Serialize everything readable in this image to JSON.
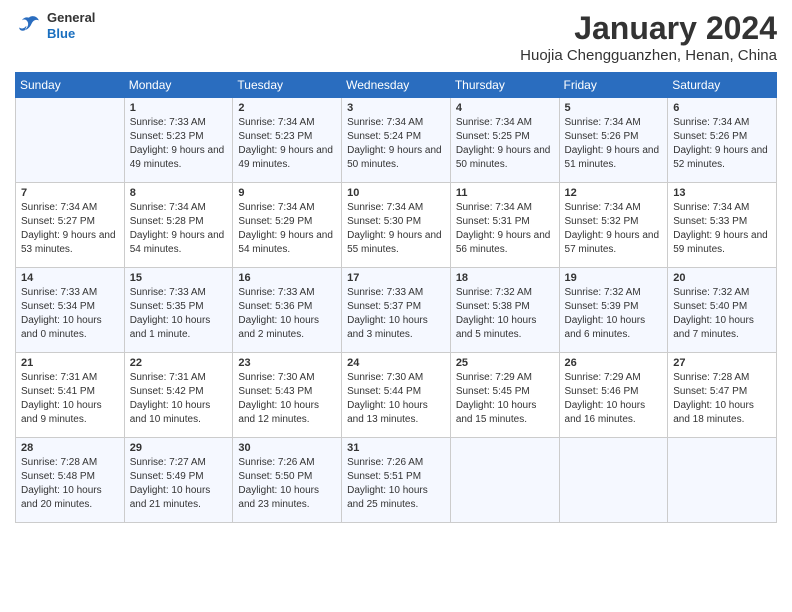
{
  "header": {
    "logo": {
      "general": "General",
      "blue": "Blue"
    },
    "title": "January 2024",
    "location": "Huojia Chengguanzhen, Henan, China"
  },
  "weekdays": [
    "Sunday",
    "Monday",
    "Tuesday",
    "Wednesday",
    "Thursday",
    "Friday",
    "Saturday"
  ],
  "weeks": [
    [
      {
        "day": "",
        "sunrise": "",
        "sunset": "",
        "daylight": ""
      },
      {
        "day": "1",
        "sunrise": "Sunrise: 7:33 AM",
        "sunset": "Sunset: 5:23 PM",
        "daylight": "Daylight: 9 hours and 49 minutes."
      },
      {
        "day": "2",
        "sunrise": "Sunrise: 7:34 AM",
        "sunset": "Sunset: 5:23 PM",
        "daylight": "Daylight: 9 hours and 49 minutes."
      },
      {
        "day": "3",
        "sunrise": "Sunrise: 7:34 AM",
        "sunset": "Sunset: 5:24 PM",
        "daylight": "Daylight: 9 hours and 50 minutes."
      },
      {
        "day": "4",
        "sunrise": "Sunrise: 7:34 AM",
        "sunset": "Sunset: 5:25 PM",
        "daylight": "Daylight: 9 hours and 50 minutes."
      },
      {
        "day": "5",
        "sunrise": "Sunrise: 7:34 AM",
        "sunset": "Sunset: 5:26 PM",
        "daylight": "Daylight: 9 hours and 51 minutes."
      },
      {
        "day": "6",
        "sunrise": "Sunrise: 7:34 AM",
        "sunset": "Sunset: 5:26 PM",
        "daylight": "Daylight: 9 hours and 52 minutes."
      }
    ],
    [
      {
        "day": "7",
        "sunrise": "Sunrise: 7:34 AM",
        "sunset": "Sunset: 5:27 PM",
        "daylight": "Daylight: 9 hours and 53 minutes."
      },
      {
        "day": "8",
        "sunrise": "Sunrise: 7:34 AM",
        "sunset": "Sunset: 5:28 PM",
        "daylight": "Daylight: 9 hours and 54 minutes."
      },
      {
        "day": "9",
        "sunrise": "Sunrise: 7:34 AM",
        "sunset": "Sunset: 5:29 PM",
        "daylight": "Daylight: 9 hours and 54 minutes."
      },
      {
        "day": "10",
        "sunrise": "Sunrise: 7:34 AM",
        "sunset": "Sunset: 5:30 PM",
        "daylight": "Daylight: 9 hours and 55 minutes."
      },
      {
        "day": "11",
        "sunrise": "Sunrise: 7:34 AM",
        "sunset": "Sunset: 5:31 PM",
        "daylight": "Daylight: 9 hours and 56 minutes."
      },
      {
        "day": "12",
        "sunrise": "Sunrise: 7:34 AM",
        "sunset": "Sunset: 5:32 PM",
        "daylight": "Daylight: 9 hours and 57 minutes."
      },
      {
        "day": "13",
        "sunrise": "Sunrise: 7:34 AM",
        "sunset": "Sunset: 5:33 PM",
        "daylight": "Daylight: 9 hours and 59 minutes."
      }
    ],
    [
      {
        "day": "14",
        "sunrise": "Sunrise: 7:33 AM",
        "sunset": "Sunset: 5:34 PM",
        "daylight": "Daylight: 10 hours and 0 minutes."
      },
      {
        "day": "15",
        "sunrise": "Sunrise: 7:33 AM",
        "sunset": "Sunset: 5:35 PM",
        "daylight": "Daylight: 10 hours and 1 minute."
      },
      {
        "day": "16",
        "sunrise": "Sunrise: 7:33 AM",
        "sunset": "Sunset: 5:36 PM",
        "daylight": "Daylight: 10 hours and 2 minutes."
      },
      {
        "day": "17",
        "sunrise": "Sunrise: 7:33 AM",
        "sunset": "Sunset: 5:37 PM",
        "daylight": "Daylight: 10 hours and 3 minutes."
      },
      {
        "day": "18",
        "sunrise": "Sunrise: 7:32 AM",
        "sunset": "Sunset: 5:38 PM",
        "daylight": "Daylight: 10 hours and 5 minutes."
      },
      {
        "day": "19",
        "sunrise": "Sunrise: 7:32 AM",
        "sunset": "Sunset: 5:39 PM",
        "daylight": "Daylight: 10 hours and 6 minutes."
      },
      {
        "day": "20",
        "sunrise": "Sunrise: 7:32 AM",
        "sunset": "Sunset: 5:40 PM",
        "daylight": "Daylight: 10 hours and 7 minutes."
      }
    ],
    [
      {
        "day": "21",
        "sunrise": "Sunrise: 7:31 AM",
        "sunset": "Sunset: 5:41 PM",
        "daylight": "Daylight: 10 hours and 9 minutes."
      },
      {
        "day": "22",
        "sunrise": "Sunrise: 7:31 AM",
        "sunset": "Sunset: 5:42 PM",
        "daylight": "Daylight: 10 hours and 10 minutes."
      },
      {
        "day": "23",
        "sunrise": "Sunrise: 7:30 AM",
        "sunset": "Sunset: 5:43 PM",
        "daylight": "Daylight: 10 hours and 12 minutes."
      },
      {
        "day": "24",
        "sunrise": "Sunrise: 7:30 AM",
        "sunset": "Sunset: 5:44 PM",
        "daylight": "Daylight: 10 hours and 13 minutes."
      },
      {
        "day": "25",
        "sunrise": "Sunrise: 7:29 AM",
        "sunset": "Sunset: 5:45 PM",
        "daylight": "Daylight: 10 hours and 15 minutes."
      },
      {
        "day": "26",
        "sunrise": "Sunrise: 7:29 AM",
        "sunset": "Sunset: 5:46 PM",
        "daylight": "Daylight: 10 hours and 16 minutes."
      },
      {
        "day": "27",
        "sunrise": "Sunrise: 7:28 AM",
        "sunset": "Sunset: 5:47 PM",
        "daylight": "Daylight: 10 hours and 18 minutes."
      }
    ],
    [
      {
        "day": "28",
        "sunrise": "Sunrise: 7:28 AM",
        "sunset": "Sunset: 5:48 PM",
        "daylight": "Daylight: 10 hours and 20 minutes."
      },
      {
        "day": "29",
        "sunrise": "Sunrise: 7:27 AM",
        "sunset": "Sunset: 5:49 PM",
        "daylight": "Daylight: 10 hours and 21 minutes."
      },
      {
        "day": "30",
        "sunrise": "Sunrise: 7:26 AM",
        "sunset": "Sunset: 5:50 PM",
        "daylight": "Daylight: 10 hours and 23 minutes."
      },
      {
        "day": "31",
        "sunrise": "Sunrise: 7:26 AM",
        "sunset": "Sunset: 5:51 PM",
        "daylight": "Daylight: 10 hours and 25 minutes."
      },
      {
        "day": "",
        "sunrise": "",
        "sunset": "",
        "daylight": ""
      },
      {
        "day": "",
        "sunrise": "",
        "sunset": "",
        "daylight": ""
      },
      {
        "day": "",
        "sunrise": "",
        "sunset": "",
        "daylight": ""
      }
    ]
  ]
}
